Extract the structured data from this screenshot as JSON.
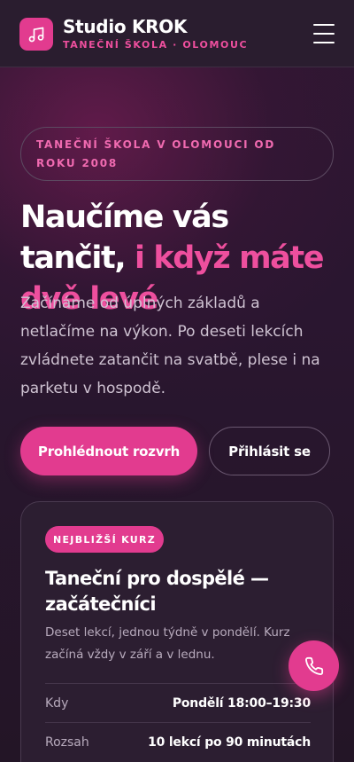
{
  "header": {
    "brand_title": "Studio KROK",
    "brand_subtitle": "TANEČNÍ ŠKOLA · OLOMOUC",
    "logo_icon": "music-note-icon",
    "menu_icon": "hamburger-menu-icon"
  },
  "hero": {
    "eyebrow": "TANEČNÍ ŠKOLA V OLOMOUCI OD ROKU 2008",
    "headline_main": "Naučíme vás tančit, ",
    "headline_accent": "i když máte dvě levé",
    "lead": "Začínáme od úplných základů a netlačíme na výkon. Po deseti lekcích zvládnete zatančit na svatbě, plese i na parketu v hospodě.",
    "primary_button": "Prohlédnout rozvrh",
    "secondary_button": "Přihlásit se"
  },
  "course_card": {
    "badge": "NEJBLIŽŠÍ KURZ",
    "title": "Taneční pro dospělé — začátečníci",
    "description": "Deset lekcí, jednou týdně v pondělí. Kurz začíná vždy v září a v lednu.",
    "rows": [
      {
        "label": "Kdy",
        "value": "Pondělí 18:00–19:30"
      },
      {
        "label": "Rozsah",
        "value": "10 lekcí po 90 minutách"
      }
    ]
  },
  "fab": {
    "icon": "phone-icon"
  },
  "colors": {
    "accent": "#e23b8f",
    "accent_text": "#ee4f9e",
    "background": "#25172a"
  }
}
